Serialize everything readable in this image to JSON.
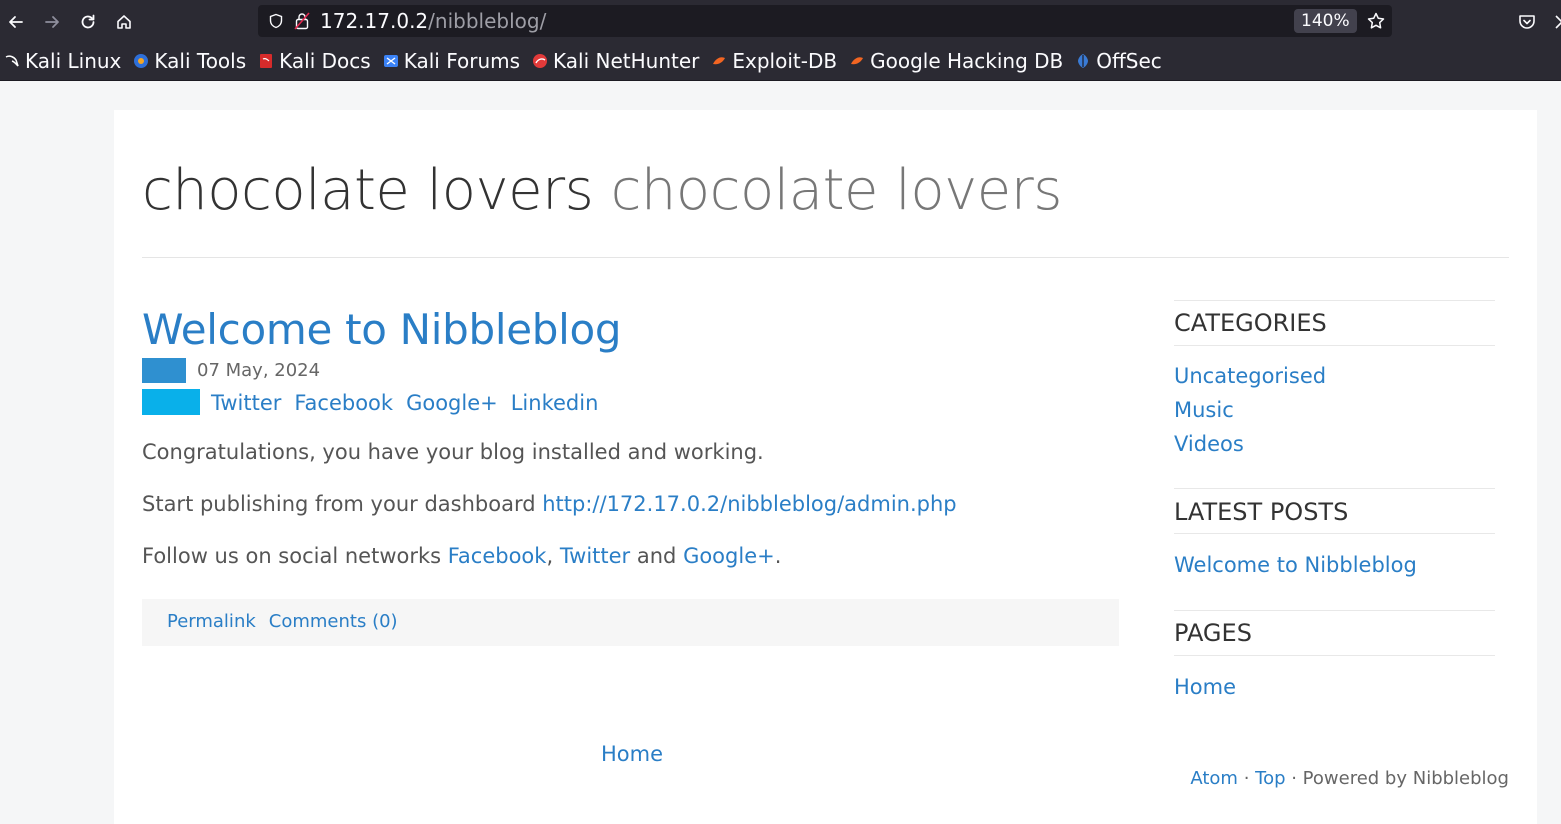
{
  "browser": {
    "url_host": "172.17.0.2",
    "url_path": "/nibbleblog/",
    "zoom": "140%",
    "bookmarks": [
      {
        "label": "Kali Linux",
        "icon": "kali-dragon-icon",
        "color": "#ffffff"
      },
      {
        "label": "Kali Tools",
        "icon": "kali-tools-icon",
        "color": "#2e6fd8"
      },
      {
        "label": "Kali Docs",
        "icon": "kali-docs-icon",
        "color": "#d72b2b"
      },
      {
        "label": "Kali Forums",
        "icon": "kali-forums-icon",
        "color": "#3b82f6"
      },
      {
        "label": "Kali NetHunter",
        "icon": "kali-nethunter-icon",
        "color": "#e23a3a"
      },
      {
        "label": "Exploit-DB",
        "icon": "exploit-db-icon",
        "color": "#f26522"
      },
      {
        "label": "Google Hacking DB",
        "icon": "ghdb-icon",
        "color": "#f26522"
      },
      {
        "label": "OffSec",
        "icon": "offsec-icon",
        "color": "#3a7bd5"
      }
    ]
  },
  "site": {
    "title": "chocolate lovers",
    "slogan": "chocolate lovers"
  },
  "post": {
    "title": "Welcome to Nibbleblog",
    "date": "07 May, 2024",
    "share": [
      "Twitter",
      "Facebook",
      "Google+",
      "Linkedin"
    ],
    "p1": "Congratulations, you have your blog installed and working.",
    "p2_text": "Start publishing from your dashboard ",
    "p2_link": "http://172.17.0.2/nibbleblog/admin.php",
    "p3_text": "Follow us on social networks ",
    "p3_link1": "Facebook",
    "p3_sep1": ", ",
    "p3_link2": "Twitter",
    "p3_sep2": " and ",
    "p3_link3": "Google+",
    "p3_end": ".",
    "permalink": "Permalink",
    "comments": "Comments (0)"
  },
  "pager": {
    "home": "Home"
  },
  "sidebar": {
    "categories_title": "CATEGORIES",
    "categories": [
      "Uncategorised",
      "Music",
      "Videos"
    ],
    "latest_title": "LATEST POSTS",
    "latest": [
      "Welcome to Nibbleblog"
    ],
    "pages_title": "PAGES",
    "pages": [
      "Home"
    ]
  },
  "footer": {
    "atom": "Atom",
    "sep1": " · ",
    "top": "Top",
    "powered": " · Powered by Nibbleblog"
  },
  "colors": {
    "link": "#2a7ec6",
    "date_badge": "#2f90d0",
    "share_badge": "#09b0ea",
    "chrome_bg": "#2b2a33"
  }
}
